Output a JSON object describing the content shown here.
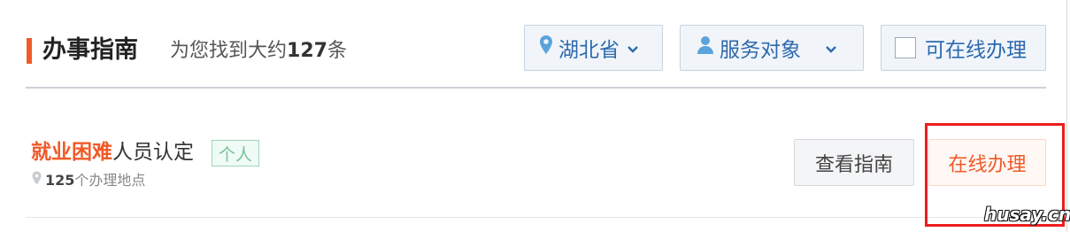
{
  "section": {
    "title": "办事指南",
    "result_prefix": "为您找到大约",
    "result_count": "127",
    "result_suffix": "条"
  },
  "filters": {
    "province": {
      "label": "湖北省",
      "icon": "location-pin-icon"
    },
    "audience": {
      "label": "服务对象",
      "icon": "person-icon"
    },
    "online_only": {
      "label": "可在线办理",
      "checked": false
    }
  },
  "items": [
    {
      "name_highlight": "就业困难",
      "name_rest": "人员认定",
      "tag": "个人",
      "location_count": "125",
      "location_suffix": "个办理地点",
      "guide_button": "查看指南",
      "apply_button": "在线办理"
    }
  ],
  "watermark": "husay.cn",
  "colors": {
    "accent": "#f05a28",
    "filter_text": "#2d6aad",
    "filter_bg": "#f1f5fa",
    "tag_green": "#7bbf9a",
    "annotation_red": "#ee1d1d"
  }
}
